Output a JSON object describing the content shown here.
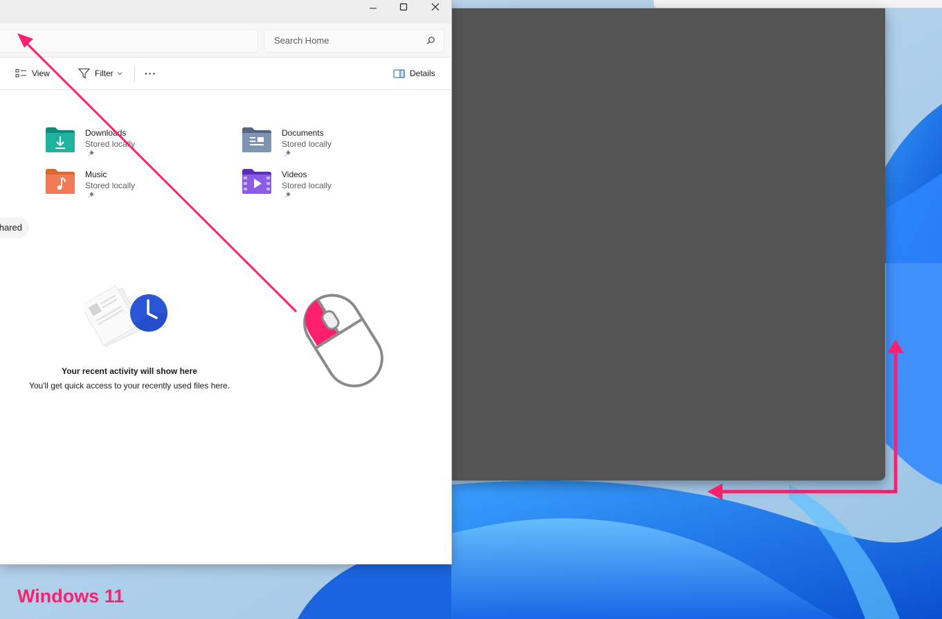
{
  "explorer": {
    "search": {
      "placeholder": "Search Home"
    },
    "toolbar": {
      "view_label": "View",
      "filter_label": "Filter",
      "more_label": "···",
      "details_label": "Details"
    },
    "quick_access": [
      {
        "name": "Downloads",
        "status": "Stored locally",
        "icon": "downloads-folder-icon",
        "color": "#1aa593"
      },
      {
        "name": "Documents",
        "status": "Stored locally",
        "icon": "documents-folder-icon",
        "color": "#6f86a8"
      },
      {
        "name": "Music",
        "status": "Stored locally",
        "icon": "music-folder-icon",
        "color": "#f06a4a"
      },
      {
        "name": "Videos",
        "status": "Stored locally",
        "icon": "videos-folder-icon",
        "color": "#7b4fd6"
      }
    ],
    "shared_tab": "hared",
    "recent": {
      "title": "Your recent activity will show here",
      "subtitle": "You'll get quick access to your recently used files here."
    }
  },
  "annotation": {
    "brand": "Windows 11",
    "accent": "#ff1f6f"
  }
}
